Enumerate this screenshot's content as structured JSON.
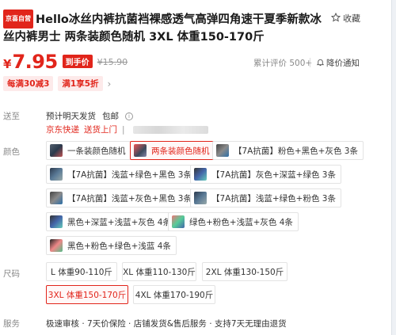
{
  "product": {
    "tag": "京喜自营",
    "title": "Hello冰丝内裤抗菌裆裸感透气高弹四角速干夏季新款冰丝内裤男士 两条装颜色随机 3XL 体重150-170斤",
    "favorite_label": "收藏"
  },
  "price": {
    "currency": "¥",
    "value": "7.95",
    "after_badge": "到手价",
    "original": "¥15.90",
    "review_text": "累计评价 500+",
    "notify_label": "降价通知"
  },
  "promos": [
    "每满30减3",
    "满1享5折"
  ],
  "shipping": {
    "label": "送至",
    "eta": "预计明天发货",
    "free_shipping": "包邮",
    "express": "京东快递",
    "send_to": "送货上门"
  },
  "colors": {
    "label": "颜色",
    "options": [
      {
        "text": "一条装颜色随机",
        "selected": false
      },
      {
        "text": "两条装颜色随机",
        "selected": true
      },
      {
        "text": "【7A抗菌】粉色+黑色+灰色 3条",
        "selected": false
      },
      {
        "text": "【7A抗菌】浅蓝+绿色+黑色 3条",
        "selected": false
      },
      {
        "text": "【7A抗菌】灰色+深蓝+绿色 3条",
        "selected": false
      },
      {
        "text": "【7A抗菌】浅蓝+灰色+黑色 3条",
        "selected": false
      },
      {
        "text": "【7A抗菌】浅蓝+绿色+粉色 3条",
        "selected": false
      },
      {
        "text": "黑色+深蓝+浅蓝+灰色 4条",
        "selected": false
      },
      {
        "text": "绿色+粉色+浅蓝+灰色 4条",
        "selected": false
      },
      {
        "text": "黑色+粉色+绿色+浅蓝 4条",
        "selected": false
      }
    ]
  },
  "sizes": {
    "label": "尺码",
    "options": [
      {
        "text": "L 体重90-110斤",
        "selected": false
      },
      {
        "text": "XL 体重110-130斤",
        "selected": false
      },
      {
        "text": "2XL 体重130-150斤",
        "selected": false
      },
      {
        "text": "3XL 体重150-170斤",
        "selected": true
      },
      {
        "text": "4XL 体重170-190斤",
        "selected": false
      }
    ]
  },
  "service": {
    "label": "服务",
    "text": "极速审核 · 7天价保险 · 店铺发货&售后服务 · 支持7天无理由退货"
  }
}
